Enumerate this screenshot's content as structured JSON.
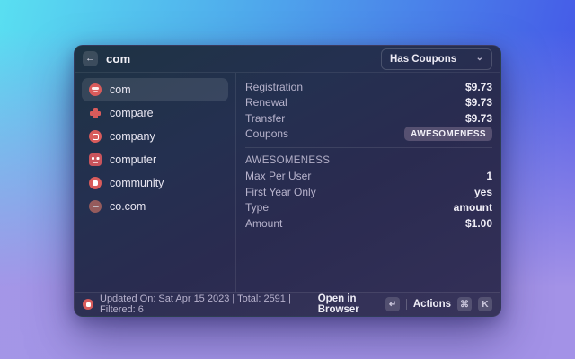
{
  "window": {
    "header": {
      "back_icon": "←",
      "title": "com",
      "filter_dropdown": {
        "value": "Has Coupons",
        "chevron_icon": "⌄"
      }
    },
    "sidebar": {
      "items": [
        {
          "label": "com",
          "selected": true
        },
        {
          "label": "compare",
          "selected": false
        },
        {
          "label": "company",
          "selected": false
        },
        {
          "label": "computer",
          "selected": false
        },
        {
          "label": "community",
          "selected": false
        },
        {
          "label": "co.com",
          "selected": false
        }
      ]
    },
    "detail": {
      "pricing_rows": [
        {
          "label": "Registration",
          "value": "$9.73"
        },
        {
          "label": "Renewal",
          "value": "$9.73"
        },
        {
          "label": "Transfer",
          "value": "$9.73"
        }
      ],
      "coupons_row": {
        "label": "Coupons",
        "badge": "AWESOMENESS"
      },
      "coupon_section": {
        "title": "AWESOMENESS",
        "rows": [
          {
            "label": "Max Per User",
            "value": "1"
          },
          {
            "label": "First Year Only",
            "value": "yes"
          },
          {
            "label": "Type",
            "value": "amount"
          },
          {
            "label": "Amount",
            "value": "$1.00"
          }
        ]
      }
    },
    "footer": {
      "status": "Updated On: Sat Apr 15 2023 | Total: 2591 | Filtered: 6",
      "primary_action": "Open in Browser",
      "primary_key": "↵",
      "actions_label": "Actions",
      "actions_key_1": "⌘",
      "actions_key_2": "K"
    }
  },
  "colors": {
    "accent_red": "#d85b5b",
    "badge_bg": "#565071"
  }
}
